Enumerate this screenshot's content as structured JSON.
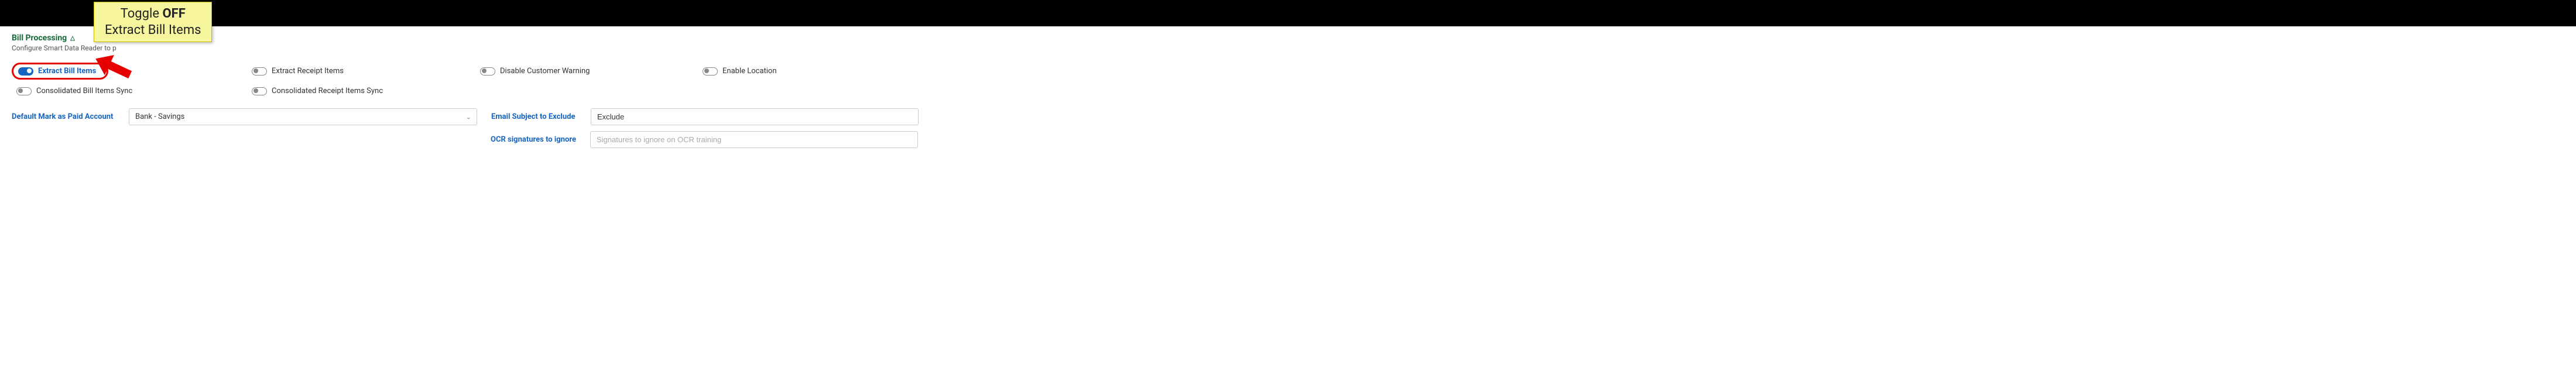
{
  "callout": {
    "line1_pre": "Toggle ",
    "line1_bold": "OFF",
    "line2": "Extract Bill Items"
  },
  "section": {
    "title": "Bill Processing",
    "subtitle_visible": "Configure Smart Data Reader to p"
  },
  "toggles": {
    "extractBillItems": {
      "label": "Extract Bill Items",
      "on": true
    },
    "extractReceiptItems": {
      "label": "Extract Receipt Items",
      "on": false
    },
    "disableCustomerWarning": {
      "label": "Disable Customer Warning",
      "on": false
    },
    "enableLocation": {
      "label": "Enable Location",
      "on": false
    },
    "consolidatedBillItemsSync": {
      "label": "Consolidated Bill Items Sync",
      "on": false
    },
    "consolidatedReceiptItemsSync": {
      "label": "Consolidated Receipt Items Sync",
      "on": false
    }
  },
  "fields": {
    "defaultPaidAccount": {
      "label": "Default Mark as Paid Account",
      "value": "Bank - Savings"
    },
    "emailSubjectExclude": {
      "label": "Email Subject to Exclude",
      "value": "Exclude"
    },
    "ocrSignatures": {
      "label": "OCR signatures to ignore",
      "placeholder": "Signatures to ignore on OCR training",
      "value": ""
    }
  },
  "colors": {
    "brandGreen": "#176937",
    "brandBlue": "#1565c0",
    "calloutRed": "#e60000",
    "calloutYellow": "#f7f59e"
  }
}
